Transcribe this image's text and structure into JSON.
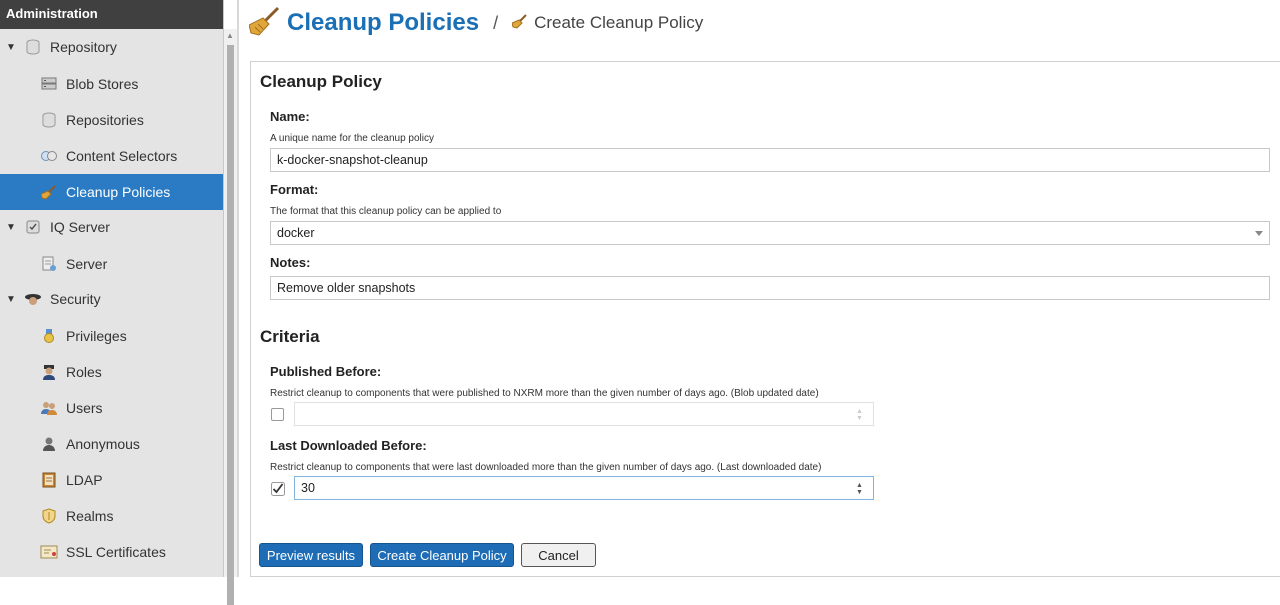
{
  "sidebar": {
    "header": "Administration",
    "items": [
      {
        "label": "Repository",
        "icon": "database-icon",
        "level": 0,
        "expanded": true
      },
      {
        "label": "Blob Stores",
        "icon": "server-icon",
        "level": 1
      },
      {
        "label": "Repositories",
        "icon": "database-icon",
        "level": 1
      },
      {
        "label": "Content Selectors",
        "icon": "selectors-icon",
        "level": 1
      },
      {
        "label": "Cleanup Policies",
        "icon": "broom-icon",
        "level": 1,
        "selected": true
      },
      {
        "label": "IQ Server",
        "icon": "iq-icon",
        "level": 0,
        "expanded": true
      },
      {
        "label": "Server",
        "icon": "server-doc-icon",
        "level": 1
      },
      {
        "label": "Security",
        "icon": "security-icon",
        "level": 0,
        "expanded": true
      },
      {
        "label": "Privileges",
        "icon": "medal-icon",
        "level": 1
      },
      {
        "label": "Roles",
        "icon": "role-icon",
        "level": 1
      },
      {
        "label": "Users",
        "icon": "users-icon",
        "level": 1
      },
      {
        "label": "Anonymous",
        "icon": "user-icon",
        "level": 1
      },
      {
        "label": "LDAP",
        "icon": "book-icon",
        "level": 1
      },
      {
        "label": "Realms",
        "icon": "shield-icon",
        "level": 1
      },
      {
        "label": "SSL Certificates",
        "icon": "certificate-icon",
        "level": 1
      }
    ]
  },
  "breadcrumb": {
    "title": "Cleanup Policies",
    "separator": "/",
    "current": "Create Cleanup Policy"
  },
  "form": {
    "section_title": "Cleanup Policy",
    "name": {
      "label": "Name:",
      "help": "A unique name for the cleanup policy",
      "value": "k-docker-snapshot-cleanup"
    },
    "format": {
      "label": "Format:",
      "help": "The format that this cleanup policy can be applied to",
      "value": "docker"
    },
    "notes": {
      "label": "Notes:",
      "value": "Remove older snapshots"
    },
    "criteria_title": "Criteria",
    "published_before": {
      "label": "Published Before:",
      "help": "Restrict cleanup to components that were published to NXRM more than the given number of days ago. (Blob updated date)",
      "checked": false,
      "value": ""
    },
    "last_downloaded_before": {
      "label": "Last Downloaded Before:",
      "help": "Restrict cleanup to components that were last downloaded more than the given number of days ago. (Last downloaded date)",
      "checked": true,
      "value": "30"
    }
  },
  "buttons": {
    "preview": "Preview results",
    "create": "Create Cleanup Policy",
    "cancel": "Cancel"
  },
  "colors": {
    "accent": "#1d6cb5",
    "selected": "#2a7bc4",
    "sidebar_bg": "#e4e4e4",
    "header_bg": "#404040"
  }
}
